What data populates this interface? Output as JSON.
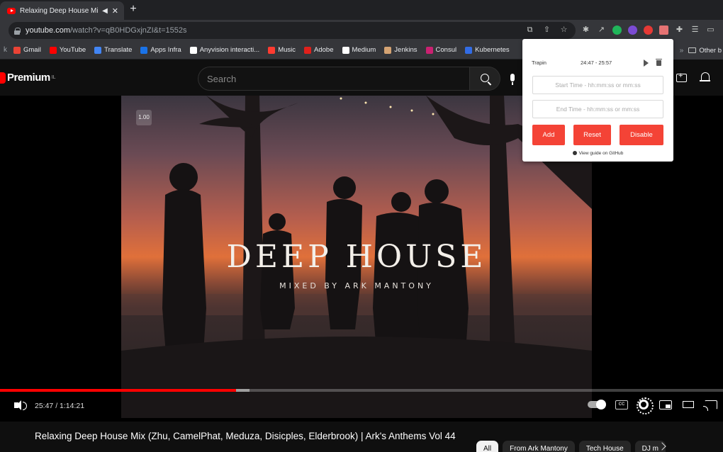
{
  "browser": {
    "tab_title": "Relaxing Deep House Mix (",
    "url_host": "youtube.com",
    "url_path": "/watch?v=qB0HDGxjnZI&t=1552s"
  },
  "bookmarks": [
    {
      "label": "Gmail",
      "color": "#ea4335"
    },
    {
      "label": "YouTube",
      "color": "#ff0000"
    },
    {
      "label": "Translate",
      "color": "#4285f4"
    },
    {
      "label": "Apps Infra",
      "color": "#1a73e8"
    },
    {
      "label": "Anyvision interacti...",
      "color": "#ffffff"
    },
    {
      "label": "Music",
      "color": "#ff3b30"
    },
    {
      "label": "Adobe",
      "color": "#e0201b"
    },
    {
      "label": "Medium",
      "color": "#ffffff"
    },
    {
      "label": "Jenkins",
      "color": "#d4a373"
    },
    {
      "label": "Consul",
      "color": "#ca2171"
    },
    {
      "label": "Kubernetes",
      "color": "#326ce5"
    }
  ],
  "other_bookmarks": "Other b",
  "youtube": {
    "logo_text": "Premium",
    "logo_region": "IL",
    "search_placeholder": "Search"
  },
  "player": {
    "speed_badge": "1.00",
    "overlay_title": "DEEP HOUSE",
    "overlay_subtitle": "MIXED BY ARK MANTONY",
    "time_display": "25:47 / 1:14:21",
    "progress_played": 0.326,
    "progress_buffered": 0.345,
    "cc_label": "CC"
  },
  "video": {
    "title": "Relaxing Deep House Mix (Zhu, CamelPhat, Meduza, Disicples, Elderbrook) | Ark's Anthems Vol 44"
  },
  "chips": [
    "All",
    "From Ark Mantony",
    "Tech House",
    "DJ m"
  ],
  "popup": {
    "name": "Trapin",
    "range": "24:47 - 25:57",
    "start_placeholder": "Start Time - hh:mm:ss or mm:ss",
    "end_placeholder": "End Time - hh:mm:ss or mm:ss",
    "add_label": "Add",
    "reset_label": "Reset",
    "disable_label": "Disable",
    "guide_label": "View guide on GitHub",
    "accent": "#f44336"
  }
}
